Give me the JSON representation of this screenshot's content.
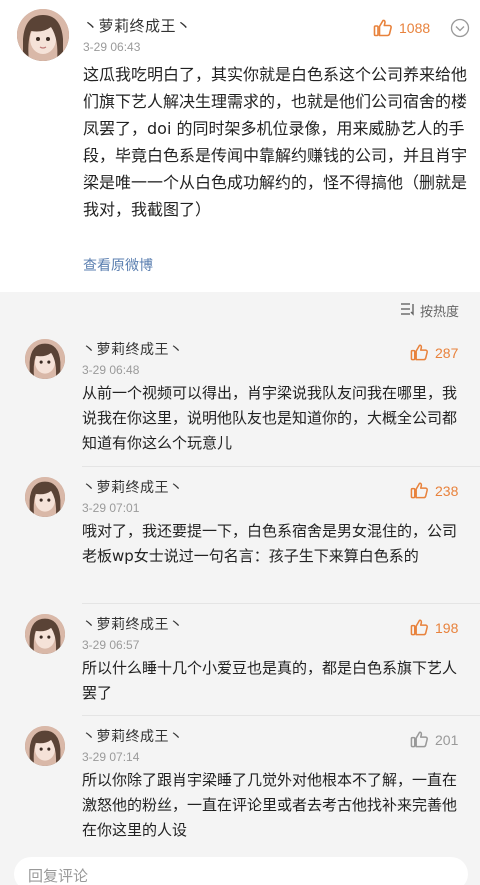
{
  "post": {
    "username": "丶萝莉终成王丶",
    "time": "3-29 06:43",
    "likes": "1088",
    "text": "这瓜我吃明白了，其实你就是白色系这个公司养来给他们旗下艺人解决生理需求的，也就是他们公司宿舍的楼凤罢了，doi 的同时架多机位录像，用来威胁艺人的手段，毕竟白色系是传闻中靠解约赚钱的公司，并且肖宇梁是唯一一个从白色成功解约的，怪不得搞他（删就是我对，我截图了）",
    "view_original": "查看原微博"
  },
  "sort_label": "按热度",
  "comments": [
    {
      "username": "丶萝莉终成王丶",
      "time": "3-29 06:48",
      "likes": "287",
      "text": "从前一个视频可以得出，肖宇梁说我队友问我在哪里，我说我在你这里，说明他队友也是知道你的，大概全公司都知道有你这么个玩意儿"
    },
    {
      "username": "丶萝莉终成王丶",
      "time": "3-29 07:01",
      "likes": "238",
      "text": "哦对了，我还要提一下，白色系宿舍是男女混住的，公司老板wp女士说过一句名言：孩子生下来算白色系的"
    },
    {
      "username": "丶萝莉终成王丶",
      "time": "3-29 06:57",
      "likes": "198",
      "text": "所以什么睡十几个小爱豆也是真的，都是白色系旗下艺人罢了"
    },
    {
      "username": "丶萝莉终成王丶",
      "time": "3-29 07:14",
      "likes": "201",
      "text": "所以你除了跟肖宇梁睡了几觉外对他根本不了解，一直在激怒他的粉丝，一直在评论里或者去考古他找补来完善他在你这里的人设"
    }
  ],
  "reply_placeholder": "回复评论",
  "colors": {
    "like_hot": "#e8823c",
    "like_normal": "#999999",
    "link": "#5b7fb0"
  },
  "icons": [
    "thumbs-up-icon",
    "more-icon",
    "sort-icon"
  ]
}
